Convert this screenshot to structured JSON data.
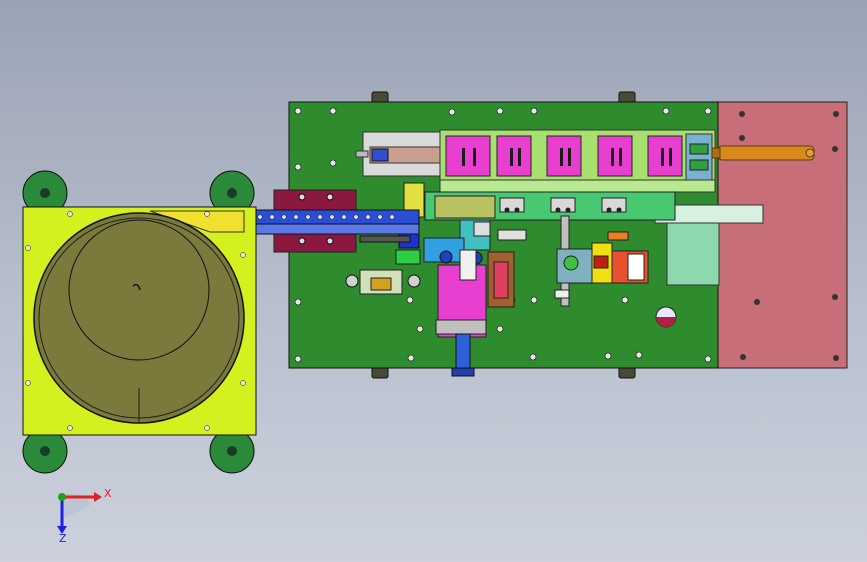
{
  "triad": {
    "x_label": "X",
    "z_label": "Z",
    "x_color": "#e02020",
    "y_color": "#20a020",
    "z_color": "#2020e0"
  },
  "colors": {
    "background_top": "#9aa3b5",
    "background_bottom": "#ccd1dc",
    "main_plate": "#2e8b2e",
    "side_plate": "#c86e78",
    "bowl_base": "#d4f01e",
    "bowl": "#7b7a3c",
    "cylinder_blocks": "#e83fd0",
    "conveyor_rail": "#2a4fd6",
    "rod": "#d88a1a"
  }
}
